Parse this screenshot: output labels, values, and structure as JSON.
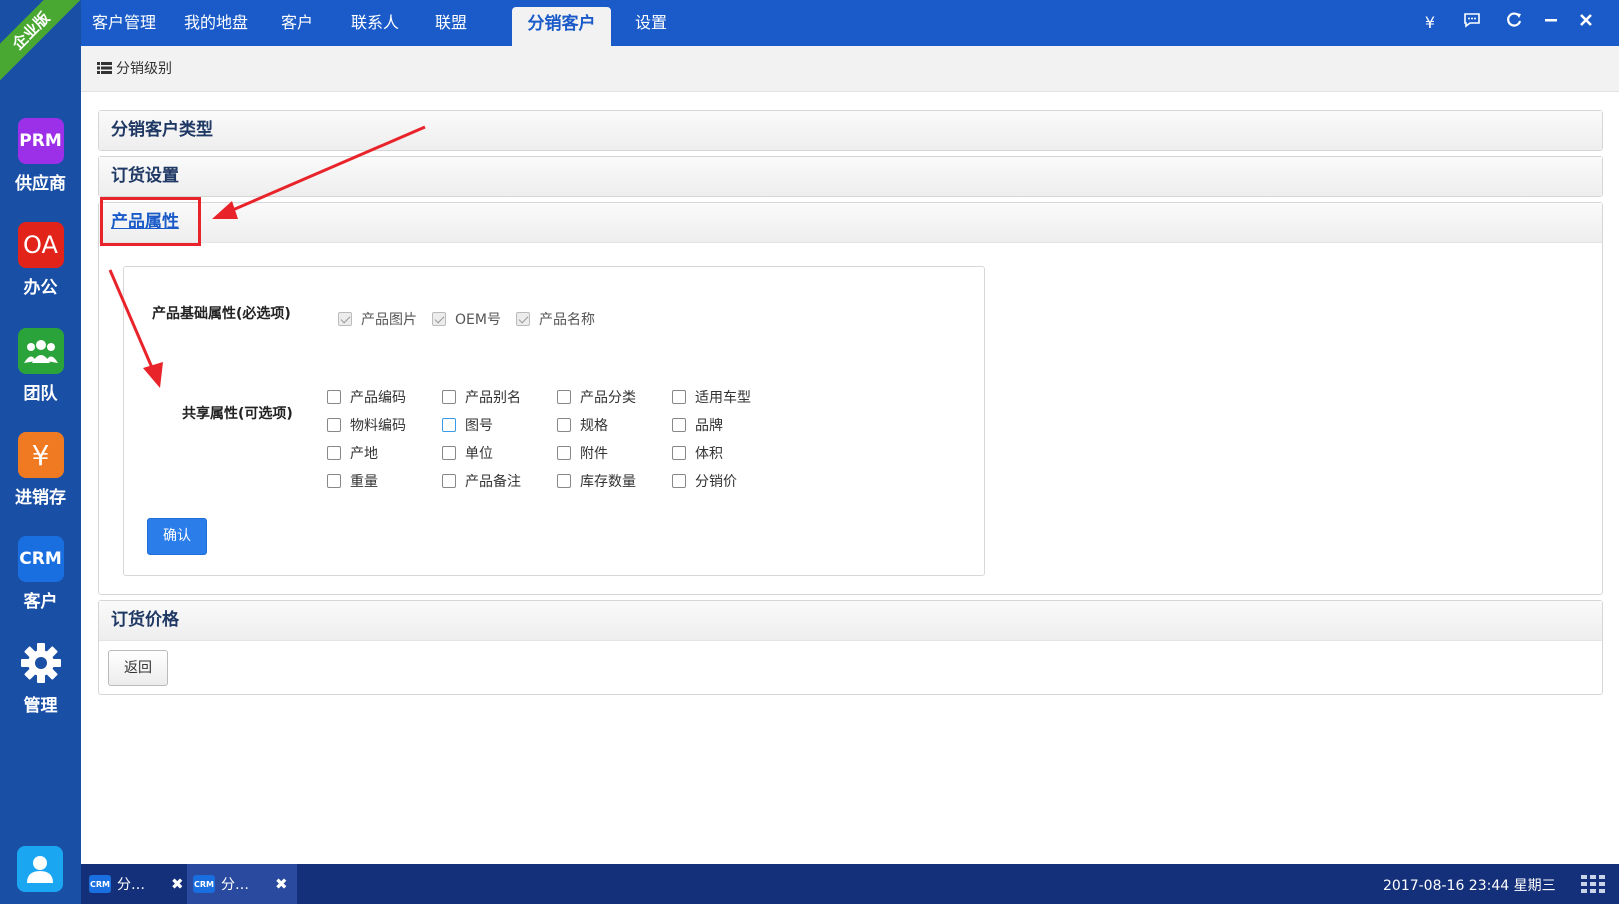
{
  "edition": "企业版",
  "apps": [
    {
      "tile": "PRM",
      "label": "供应商",
      "color": "#9b30e8"
    },
    {
      "tile": "OA",
      "label": "办公",
      "color": "#e2231a"
    },
    {
      "tile": "team-icon",
      "label": "团队",
      "color": "#2ba33b"
    },
    {
      "tile": "¥",
      "label": "进销存",
      "color": "#f07a22"
    },
    {
      "tile": "CRM",
      "label": "客户",
      "color": "#1a6fe0"
    },
    {
      "tile": "gear-icon",
      "label": "管理",
      "color": "#1a4fa6"
    }
  ],
  "topnav": {
    "brand": "客户管理",
    "tabs": [
      "我的地盘",
      "客户",
      "联系人",
      "联盟",
      "分销客户",
      "设置"
    ],
    "active_tab": "分销客户",
    "window_buttons": [
      "¥",
      "message-icon",
      "refresh-icon",
      "minimize-icon",
      "close-icon"
    ]
  },
  "subbar": {
    "crumb": "分销级别"
  },
  "panels": {
    "type": "分销客户类型",
    "order_settings": "订货设置",
    "product_attrs": "产品属性",
    "order_price": "订货价格"
  },
  "product_attrs": {
    "basic_label": "产品基础属性(必选项)",
    "basic_items": [
      "产品图片",
      "OEM号",
      "产品名称"
    ],
    "shared_label": "共享属性(可选项)",
    "shared_items": [
      [
        "产品编码",
        "产品别名",
        "产品分类",
        "适用车型"
      ],
      [
        "物料编码",
        "图号",
        "规格",
        "品牌"
      ],
      [
        "产地",
        "单位",
        "附件",
        "体积"
      ],
      [
        "重量",
        "产品备注",
        "库存数量",
        "分销价"
      ]
    ],
    "confirm": "确认"
  },
  "back": "返回",
  "taskbar": {
    "tasks": [
      {
        "icon": "CRM",
        "label": "分…"
      },
      {
        "icon": "CRM",
        "label": "分…"
      }
    ],
    "clock": "2017-08-16 23:44 星期三"
  },
  "colors": {
    "nav": "#1a5bc9",
    "rail": "#1a4fa6",
    "taskbar": "#15307a",
    "annotation": "#e8232a",
    "primary_button": "#2b7de9"
  }
}
